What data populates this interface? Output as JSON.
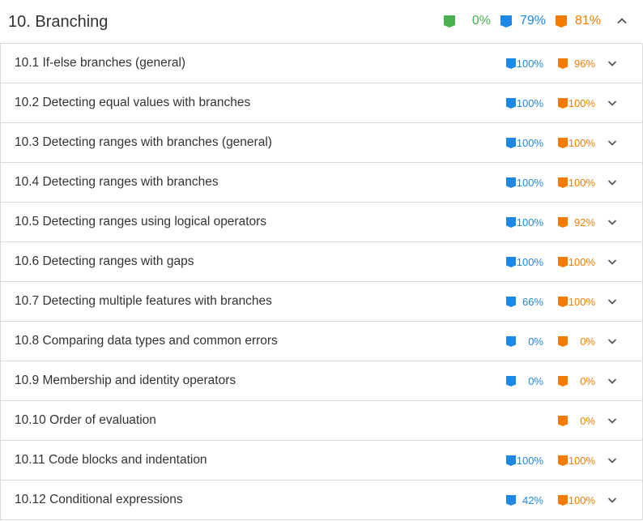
{
  "section": {
    "title": "10. Branching",
    "metrics": {
      "challenge_pct": "0%",
      "participation_pct": "79%",
      "activity_pct": "81%"
    },
    "icons": {
      "challenge": "green-book-icon",
      "participation": "blue-book-icon",
      "activity": "orange-book-icon",
      "toggle": "chevron-up-icon"
    }
  },
  "colors": {
    "green": "#4caf50",
    "blue": "#1e88e5",
    "orange": "#f57c00",
    "border": "#d9d9d9",
    "text": "#333333",
    "chevron": "#555555"
  },
  "subsections": [
    {
      "title": "10.1 If-else branches (general)",
      "participation": "100%",
      "activity": "96%"
    },
    {
      "title": "10.2 Detecting equal values with branches",
      "participation": "100%",
      "activity": "100%"
    },
    {
      "title": "10.3 Detecting ranges with branches (general)",
      "participation": "100%",
      "activity": "100%"
    },
    {
      "title": "10.4 Detecting ranges with branches",
      "participation": "100%",
      "activity": "100%"
    },
    {
      "title": "10.5 Detecting ranges using logical operators",
      "participation": "100%",
      "activity": "92%"
    },
    {
      "title": "10.6 Detecting ranges with gaps",
      "participation": "100%",
      "activity": "100%"
    },
    {
      "title": "10.7 Detecting multiple features with branches",
      "participation": "66%",
      "activity": "100%"
    },
    {
      "title": "10.8 Comparing data types and common errors",
      "participation": "0%",
      "activity": "0%"
    },
    {
      "title": "10.9 Membership and identity operators",
      "participation": "0%",
      "activity": "0%"
    },
    {
      "title": "10.10 Order of evaluation",
      "participation": null,
      "activity": "0%"
    },
    {
      "title": "10.11 Code blocks and indentation",
      "participation": "100%",
      "activity": "100%"
    },
    {
      "title": "10.12 Conditional expressions",
      "participation": "42%",
      "activity": "100%"
    }
  ]
}
